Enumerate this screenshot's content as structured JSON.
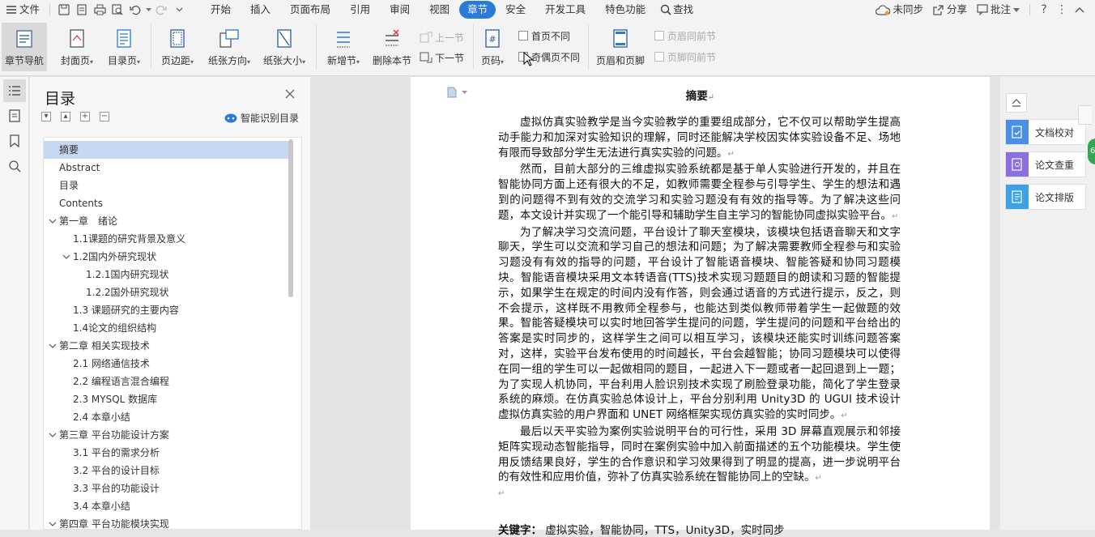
{
  "menubar": {
    "file": "文件",
    "tabs": [
      "开始",
      "插入",
      "页面布局",
      "引用",
      "审阅",
      "视图",
      "章节",
      "安全",
      "开发工具",
      "特色功能"
    ],
    "active_tab": "章节",
    "search": "查找",
    "sync": "未同步",
    "share": "分享",
    "annotate": "批注"
  },
  "ribbon": {
    "nav": "章节导航",
    "cover": "封面页",
    "toc_page": "目录页",
    "margin": "页边距",
    "orientation": "纸张方向",
    "size": "纸张大小",
    "new_section": "新增节",
    "delete_section": "删除本节",
    "prev_section": "上一节",
    "next_section": "下一节",
    "page_number": "页码",
    "first_page_diff": "首页不同",
    "odd_even_diff": "奇偶页不同",
    "header_footer": "页眉和页脚",
    "header_same_prev": "页眉同前节",
    "footer_same_prev": "页脚同前节"
  },
  "toc_panel": {
    "title": "目录",
    "smart_detect": "智能识别目录",
    "items": [
      {
        "label": "摘要",
        "level": 1,
        "selected": true
      },
      {
        "label": "Abstract",
        "level": 1
      },
      {
        "label": "目录",
        "level": 1
      },
      {
        "label": "Contents",
        "level": 1
      },
      {
        "label": "第一章　绪论",
        "level": 1,
        "expanded": true
      },
      {
        "label": "1.1课题的研究背景及意义",
        "level": 2
      },
      {
        "label": "1.2国内外研究现状",
        "level": 2,
        "expanded": true
      },
      {
        "label": "1.2.1国内研究现状",
        "level": 3
      },
      {
        "label": "1.2.2国外研究现状",
        "level": 3
      },
      {
        "label": "1.3  课题研究的主要内容",
        "level": 2
      },
      {
        "label": "1.4论文的组织结构",
        "level": 2
      },
      {
        "label": "第二章  相关实现技术",
        "level": 1,
        "expanded": true
      },
      {
        "label": "2.1    网络通信技术",
        "level": 2
      },
      {
        "label": "2.2    编程语言混合编程",
        "level": 2
      },
      {
        "label": "2.3 MYSQL 数据库",
        "level": 2
      },
      {
        "label": "2.4 本章小结",
        "level": 2
      },
      {
        "label": "第三章  平台功能设计方案",
        "level": 1,
        "expanded": true
      },
      {
        "label": "3.1  平台的需求分析",
        "level": 2
      },
      {
        "label": "3.2  平台的设计目标",
        "level": 2
      },
      {
        "label": "3.3  平台的功能设计",
        "level": 2
      },
      {
        "label": "3.4 本章小结",
        "level": 2
      },
      {
        "label": "第四章  平台功能模块实现",
        "level": 1,
        "expanded": true
      }
    ]
  },
  "document": {
    "title": "摘要",
    "paragraphs": [
      "虚拟仿真实验教学是当今实验教学的重要组成部分，它不仅可以帮助学生提高动手能力和加深对实验知识的理解，同时还能解决学校因实体实验设备不足、场地有限而导致部分学生无法进行真实实验的问题。",
      "然而，目前大部分的三维虚拟实验系统都是基于单人实验进行开发的，并且在智能协同方面上还有很大的不足，如教师需要全程参与引导学生、学生的想法和遇到的问题得不到有效的交流学习和实验习题没有有效的指导等。为了解决这些问题，本文设计并实现了一个能引导和辅助学生自主学习的智能协同虚拟实验平台。",
      "为了解决学习交流问题，平台设计了聊天室模块，该模块包括语音聊天和文字聊天，学生可以交流和学习自己的想法和问题；为了解决需要教师全程参与和实验习题没有有效的指导的问题，平台设计了智能语音模块、智能答疑和协同习题模块。智能语音模块采用文本转语音(TTS)技术实现习题题目的朗读和习题的智能提示，如果学生在规定的时间内没有作答，则会通过语音的方式进行提示，反之，则不会提示，这样既不用教师全程参与，也能达到类似教师带着学生一起做题的效果。智能答疑模块可以实时地回答学生提问的问题，学生提问的问题和平台给出的答案是实时同步的，这样学生之间可以相互学习，该模块还能实时训练问题答案对，这样，实验平台发布使用的时间越长，平台会越智能；协同习题模块可以使得在同一组的学生可以一起做相同的题目，一起进入下一题或者一起回退到上一题；为了实现人机协同，平台利用人脸识别技术实现了刷脸登录功能，简化了学生登录系统的麻烦。在仿真实验总体设计上，平台分别利用 Unity3D 的 UGUI 技术设计虚拟仿真实验的用户界面和 UNET 网络框架实现仿真实验的实时同步。",
      "最后以天平实验为案例实验说明平台的可行性，采用 3D 屏幕直观展示和邻接矩阵实现动态智能指导，同时在案例实验中加入前面描述的五个功能模块。学生使用反馈结果良好，学生的合作意识和学习效果得到了明显的提高，进一步说明平台的有效性和应用价值，弥补了仿真实验系统在智能协同上的空缺。"
    ],
    "keywords_label": "关键字：",
    "keywords": "虚拟实验，智能协同，TTS，Unity3D，实时同步"
  },
  "right_panel": {
    "proofread": "文档校对",
    "plagiarism": "论文查重",
    "format": "论文排版",
    "badge": "6"
  }
}
